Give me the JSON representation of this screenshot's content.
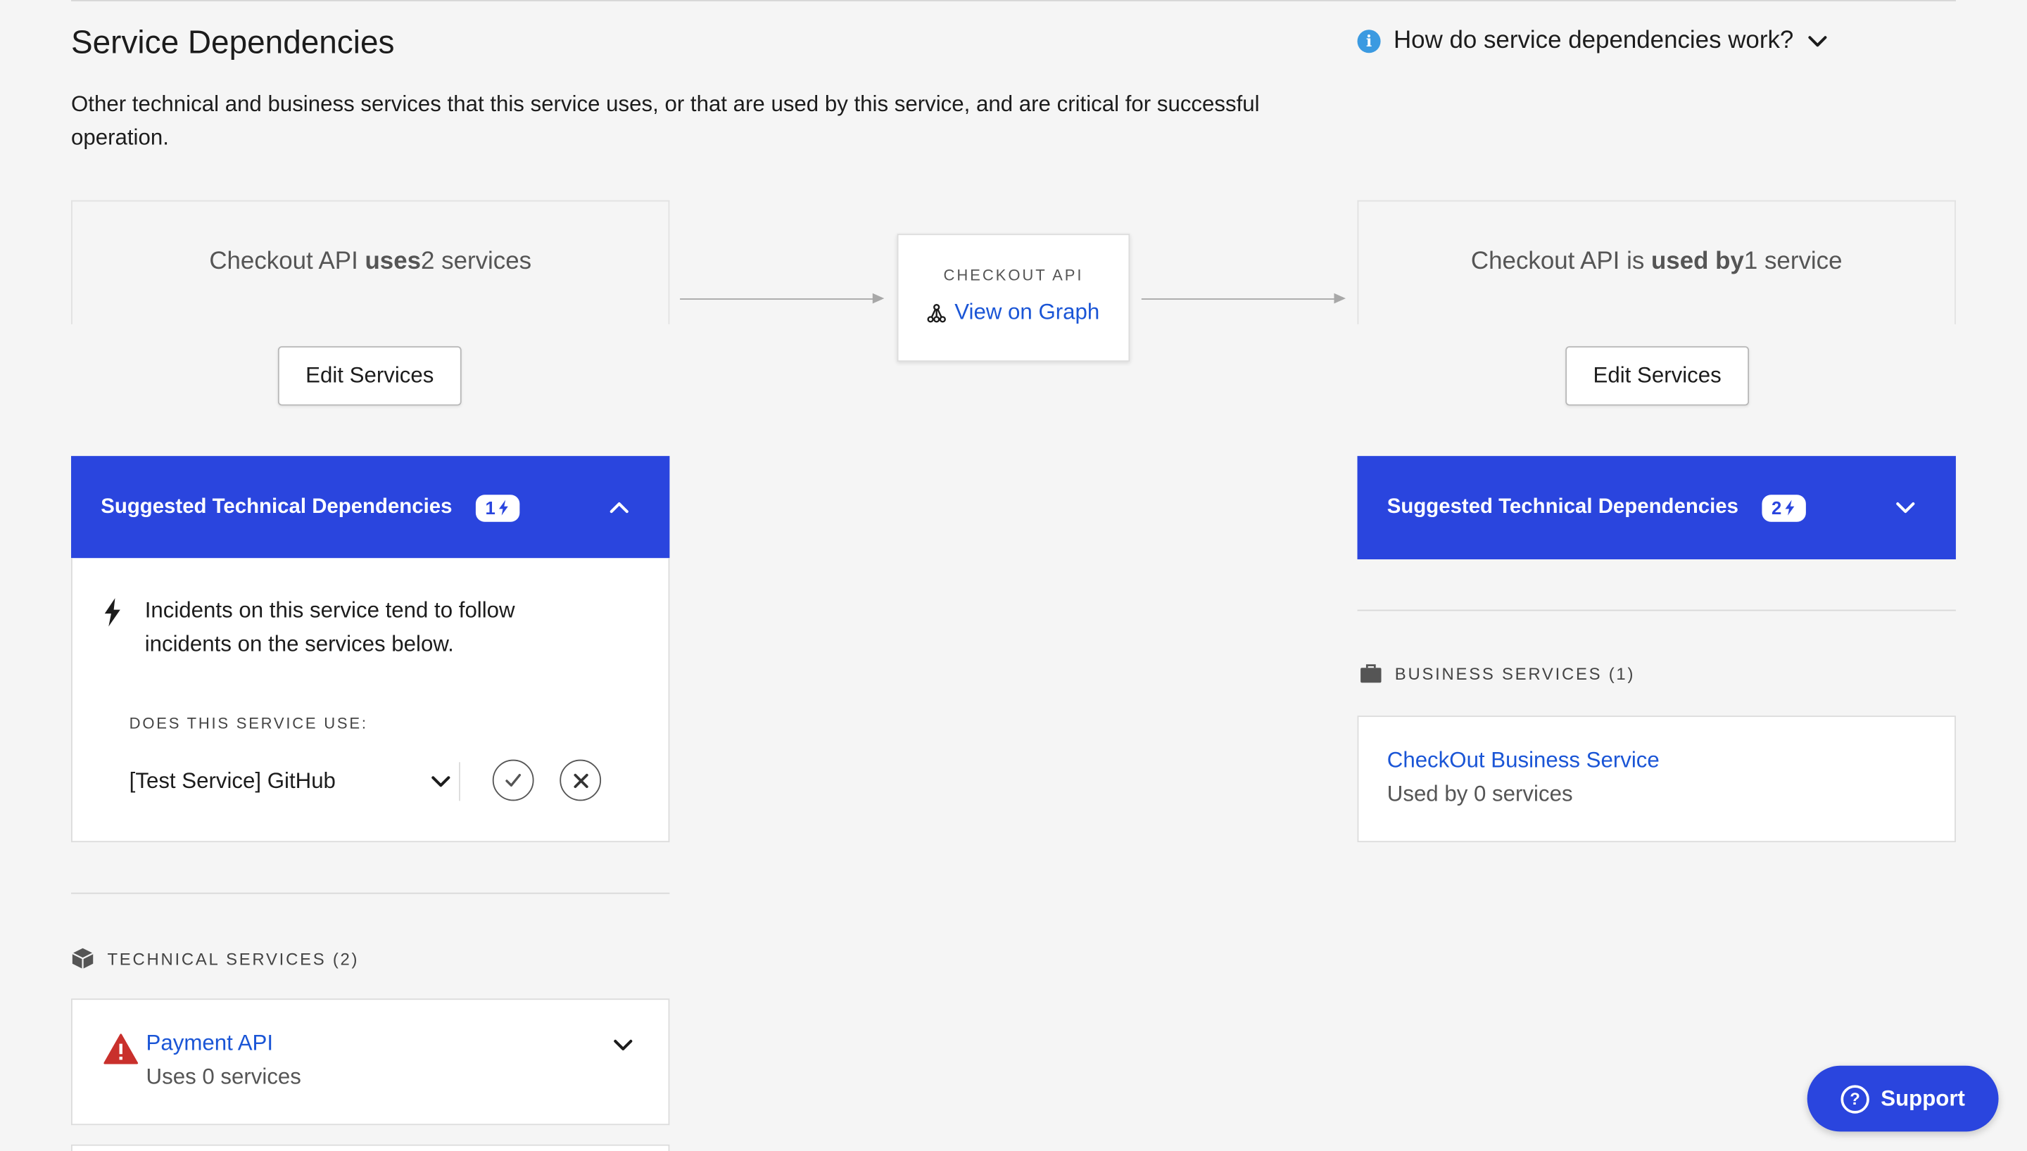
{
  "section": {
    "title": "Service Dependencies",
    "help_text": "How do service dependencies work?",
    "description": "Other technical and business services that this service uses, or that are used by this service, and are critical for successful operation."
  },
  "uses_panel": {
    "prefix": "Checkout API ",
    "verb": "uses",
    "suffix": " 2 services",
    "edit_label": "Edit Services"
  },
  "center": {
    "name": "CHECKOUT API",
    "graph_link": "View on Graph"
  },
  "used_by_panel": {
    "prefix": "Checkout API is ",
    "verb": "used by",
    "suffix": " 1 service",
    "edit_label": "Edit Services"
  },
  "suggested_left": {
    "title": "Suggested Technical Dependencies",
    "count": "1",
    "expanded": true,
    "explanation": "Incidents on this service tend to follow incidents on the services below.",
    "question": "DOES THIS SERVICE USE:",
    "selected_service": "[Test Service] GitHub"
  },
  "suggested_right": {
    "title": "Suggested Technical Dependencies",
    "count": "2",
    "expanded": false
  },
  "technical_services": {
    "label": "TECHNICAL SERVICES (2)",
    "items": [
      {
        "name": "Payment API",
        "sub": "Uses 0 services",
        "status": "warning"
      }
    ]
  },
  "business_services": {
    "label": "BUSINESS SERVICES (1)",
    "items": [
      {
        "name": "CheckOut Business Service",
        "sub": "Used by 0 services"
      }
    ]
  },
  "support": {
    "label": "Support"
  },
  "colors": {
    "accent": "#2a45de",
    "link": "#1a55d6",
    "info": "#3b9ae1",
    "warning": "#c9302c",
    "background": "#f5f5f5"
  }
}
